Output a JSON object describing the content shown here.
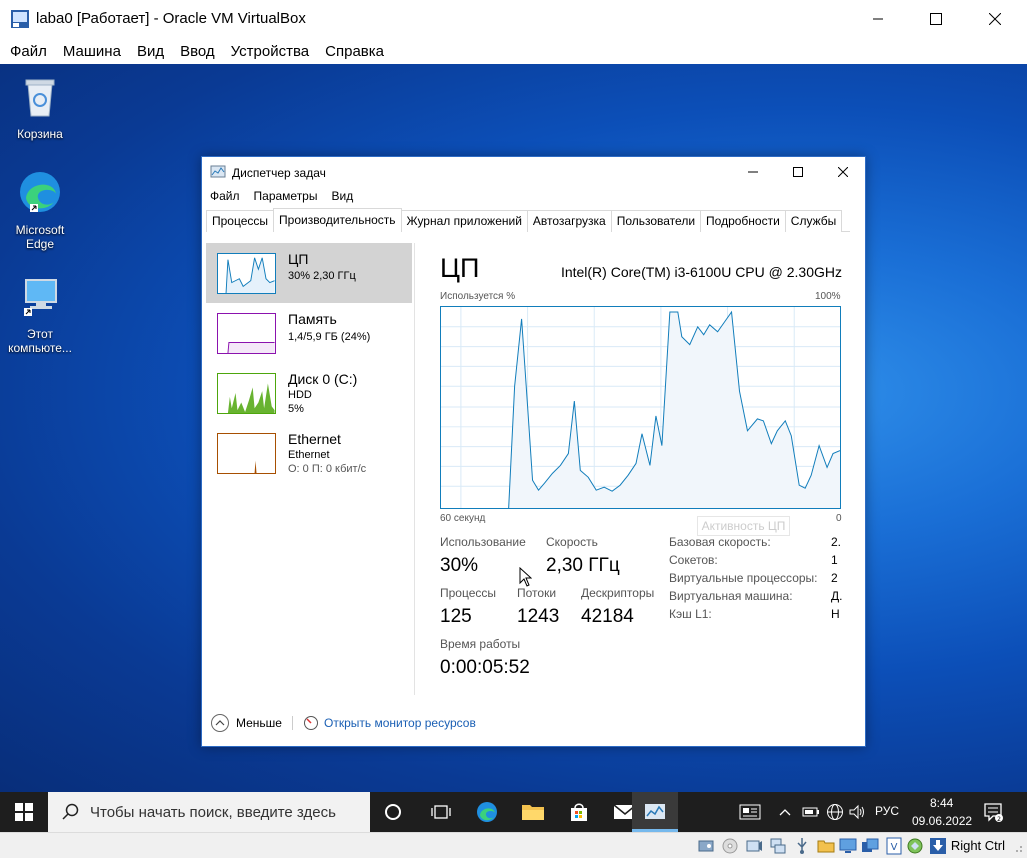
{
  "vbox": {
    "title": "laba0 [Работает] - Oracle VM VirtualBox",
    "menu": [
      "Файл",
      "Машина",
      "Вид",
      "Ввод",
      "Устройства",
      "Справка"
    ],
    "host_key": "Right Ctrl"
  },
  "desktop": {
    "icons": [
      {
        "label": "Корзина",
        "icon": "recycle-bin-icon"
      },
      {
        "label": "Microsoft Edge",
        "icon": "edge-icon"
      },
      {
        "label": "Этот компьюте...",
        "icon": "computer-icon"
      }
    ]
  },
  "taskmgr": {
    "title": "Диспетчер задач",
    "menu": [
      "Файл",
      "Параметры",
      "Вид"
    ],
    "tabs": [
      "Процессы",
      "Производительность",
      "Журнал приложений",
      "Автозагрузка",
      "Пользователи",
      "Подробности",
      "Службы"
    ],
    "active_tab": 1,
    "sidebar": [
      {
        "name": "ЦП",
        "line1": "30%  2,30 ГГц",
        "line2": "",
        "color": "#117dbb"
      },
      {
        "name": "Память",
        "line1": "1,4/5,9 ГБ (24%)",
        "line2": "",
        "color": "#8b12ae"
      },
      {
        "name": "Диск 0 (C:)",
        "line1": "HDD",
        "line2": "5%",
        "color": "#4da60c"
      },
      {
        "name": "Ethernet",
        "line1": "Ethernet",
        "line2": "О: 0 П: 0 кбит/с",
        "color": "#a74f01"
      }
    ],
    "main": {
      "title": "ЦП",
      "cpu_model": "Intel(R) Core(TM) i3-6100U CPU @ 2.30GHz",
      "graph_top_left": "Используется %",
      "graph_top_right": "100%",
      "graph_bottom_left": "60 секунд",
      "graph_bottom_right": "0",
      "watermark": "Активность ЦП",
      "usage_label": "Использование",
      "usage_value": "30%",
      "speed_label": "Скорость",
      "speed_value": "2,30 ГГц",
      "processes_label": "Процессы",
      "processes_value": "125",
      "threads_label": "Потоки",
      "threads_value": "1243",
      "handles_label": "Дескрипторы",
      "handles_value": "42184",
      "uptime_label": "Время работы",
      "uptime_value": "0:00:05:52",
      "details": [
        {
          "label": "Базовая скорость:",
          "value": "2."
        },
        {
          "label": "Сокетов:",
          "value": "1"
        },
        {
          "label": "Виртуальные процессоры:",
          "value": "2"
        },
        {
          "label": "Виртуальная машина:",
          "value": "Д."
        },
        {
          "label": "Кэш L1:",
          "value": "Н"
        }
      ]
    },
    "footer": {
      "fewer_label": "Меньше",
      "monitor_link": "Открыть монитор ресурсов"
    }
  },
  "taskbar": {
    "search_placeholder": "Чтобы начать поиск, введите здесь",
    "lang": "РУС",
    "time": "8:44",
    "date": "09.06.2022"
  }
}
